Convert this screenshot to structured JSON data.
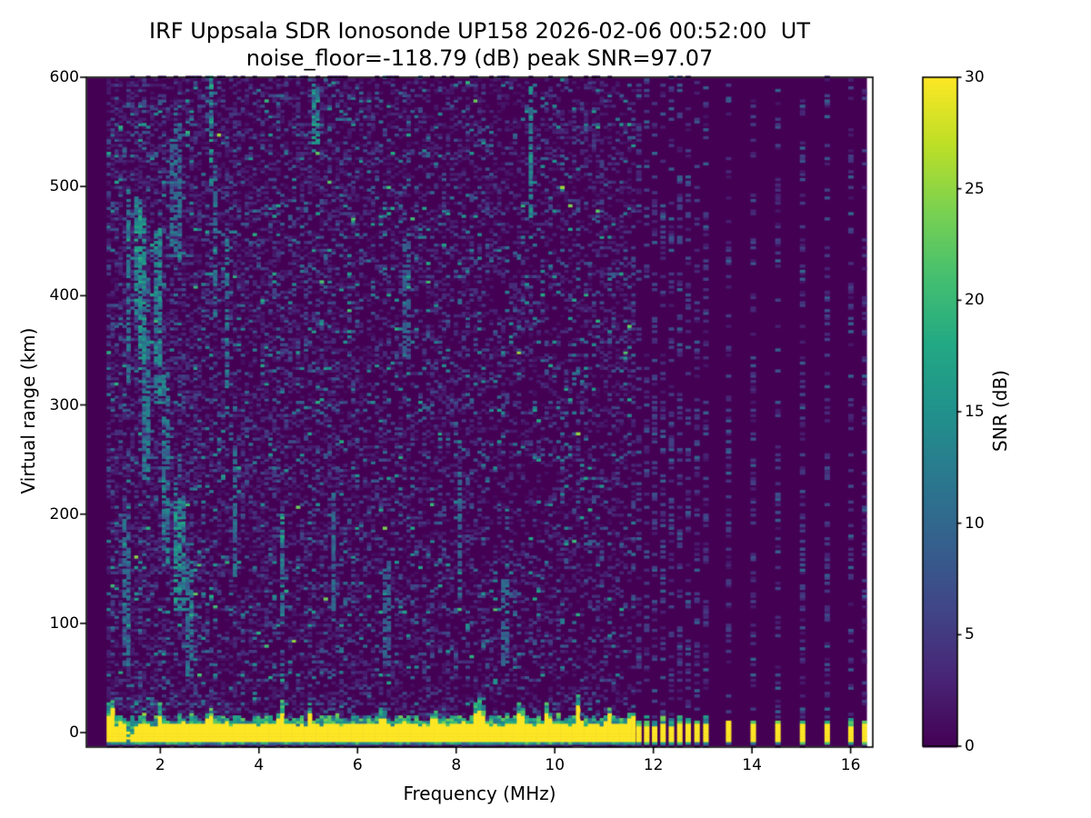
{
  "title": {
    "line1": "IRF Uppsala SDR Ionosonde UP158 2026-02-06 00:52:00  UT",
    "line2": "noise_floor=-118.79 (dB) peak SNR=97.07"
  },
  "station": "IRF Uppsala SDR Ionosonde UP158",
  "timestamp_ut": "2026-02-06 00:52:00",
  "noise_floor_db": -118.79,
  "peak_snr_db": 97.07,
  "chart_data": {
    "type": "heatmap",
    "xlabel": "Frequency (MHz)",
    "ylabel": "Virtual range (km)",
    "xlim": [
      0.5,
      16.45
    ],
    "ylim": [
      -13.3,
      600
    ],
    "xticks": [
      2,
      4,
      6,
      8,
      10,
      12,
      14,
      16
    ],
    "yticks": [
      0,
      100,
      200,
      300,
      400,
      500,
      600
    ],
    "grid": false,
    "colorbar": {
      "label": "SNR (dB)",
      "min": 0,
      "max": 30,
      "ticks": [
        0,
        5,
        10,
        15,
        20,
        25,
        30
      ],
      "colormap": "viridis",
      "colormap_stops": [
        [
          0.0,
          "#440154"
        ],
        [
          0.1,
          "#482475"
        ],
        [
          0.2,
          "#414487"
        ],
        [
          0.3,
          "#355f8d"
        ],
        [
          0.4,
          "#2a788e"
        ],
        [
          0.5,
          "#21918c"
        ],
        [
          0.6,
          "#22a884"
        ],
        [
          0.7,
          "#44bf70"
        ],
        [
          0.8,
          "#7ad151"
        ],
        [
          0.9,
          "#bddf26"
        ],
        [
          1.0,
          "#fde725"
        ]
      ]
    },
    "background_snr_db": 0,
    "dense_sweep": {
      "freq_start_mhz": 0.95,
      "freq_end_mhz": 11.66,
      "freq_step_mhz": 0.08
    },
    "sparse_frequencies_mhz": [
      11.7,
      11.86,
      12.02,
      12.19,
      12.36,
      12.53,
      12.7,
      12.88,
      13.06,
      13.52,
      14.02,
      14.52,
      15.02,
      15.52,
      16.0,
      16.28
    ],
    "range_bin_km": 2.4,
    "ground_band": {
      "km_range": [
        -8.5,
        7
      ],
      "snr_db": 30,
      "fringe_top_km": 16,
      "underside_km": [
        -11.3,
        -8.5
      ]
    },
    "band_gaps": [
      {
        "f0": 1.29,
        "f1": 1.44
      }
    ],
    "band_bumps": [
      {
        "f": 1.02,
        "w": 0.08,
        "top": 22
      },
      {
        "f": 2.0,
        "w": 0.07,
        "top": 14
      },
      {
        "f": 3.0,
        "w": 0.06,
        "top": 12
      },
      {
        "f": 4.45,
        "w": 0.06,
        "top": 16
      },
      {
        "f": 5.05,
        "w": 0.06,
        "top": 12
      },
      {
        "f": 6.5,
        "w": 0.07,
        "top": 12
      },
      {
        "f": 7.55,
        "w": 0.07,
        "top": 12
      },
      {
        "f": 8.45,
        "w": 0.12,
        "top": 19
      },
      {
        "f": 9.3,
        "w": 0.1,
        "top": 15
      },
      {
        "f": 9.85,
        "w": 0.07,
        "top": 14
      },
      {
        "f": 10.5,
        "w": 0.05,
        "top": 35
      },
      {
        "f": 11.1,
        "w": 0.06,
        "top": 13
      },
      {
        "f": 11.55,
        "w": 0.05,
        "top": 12
      }
    ],
    "echo_streaks": [
      {
        "f": 1.3,
        "w": 0.06,
        "km0": 60,
        "km1": 200,
        "s": 0.4
      },
      {
        "f": 1.35,
        "w": 0.06,
        "km0": 320,
        "km1": 500,
        "s": 0.5
      },
      {
        "f": 1.52,
        "w": 0.08,
        "km0": 380,
        "km1": 490,
        "s": 0.75
      },
      {
        "f": 1.65,
        "w": 0.06,
        "km0": 340,
        "km1": 470,
        "s": 0.7
      },
      {
        "f": 1.75,
        "w": 0.08,
        "km0": 230,
        "km1": 420,
        "s": 0.5
      },
      {
        "f": 1.95,
        "w": 0.09,
        "km0": 300,
        "km1": 460,
        "s": 0.65
      },
      {
        "f": 2.12,
        "w": 0.09,
        "km0": 150,
        "km1": 330,
        "s": 0.55
      },
      {
        "f": 2.3,
        "w": 0.1,
        "km0": 430,
        "km1": 560,
        "s": 0.4
      },
      {
        "f": 2.42,
        "w": 0.12,
        "km0": 110,
        "km1": 210,
        "s": 0.7
      },
      {
        "f": 2.6,
        "w": 0.07,
        "km0": 50,
        "km1": 160,
        "s": 0.45
      },
      {
        "f": 3.05,
        "w": 0.06,
        "km0": 500,
        "km1": 600,
        "s": 0.75
      },
      {
        "f": 3.1,
        "w": 0.05,
        "km0": 380,
        "km1": 520,
        "s": 0.45
      },
      {
        "f": 3.35,
        "w": 0.07,
        "km0": 290,
        "km1": 450,
        "s": 0.5
      },
      {
        "f": 3.52,
        "w": 0.06,
        "km0": 140,
        "km1": 260,
        "s": 0.4
      },
      {
        "f": 4.45,
        "w": 0.05,
        "km0": 90,
        "km1": 200,
        "s": 0.55
      },
      {
        "f": 5.15,
        "w": 0.06,
        "km0": 535,
        "km1": 592,
        "s": 0.7
      },
      {
        "f": 5.5,
        "w": 0.05,
        "km0": 100,
        "km1": 220,
        "s": 0.35
      },
      {
        "f": 6.6,
        "w": 0.05,
        "km0": 60,
        "km1": 160,
        "s": 0.3
      },
      {
        "f": 7.0,
        "w": 0.05,
        "km0": 340,
        "km1": 450,
        "s": 0.3
      },
      {
        "f": 8.05,
        "w": 0.05,
        "km0": 120,
        "km1": 230,
        "s": 0.35
      },
      {
        "f": 9.0,
        "w": 0.05,
        "km0": 60,
        "km1": 140,
        "s": 0.35
      },
      {
        "f": 9.5,
        "w": 0.06,
        "km0": 470,
        "km1": 590,
        "s": 0.6
      }
    ],
    "noise": {
      "density_by_freq": [
        [
          1.8,
          0.5
        ],
        [
          2.8,
          0.46
        ],
        [
          6.0,
          0.4
        ],
        [
          9.0,
          0.34
        ],
        [
          11.7,
          0.3
        ]
      ],
      "sparse_column_density": 0.28,
      "typical_speckle_db": [
        1,
        18
      ]
    }
  }
}
